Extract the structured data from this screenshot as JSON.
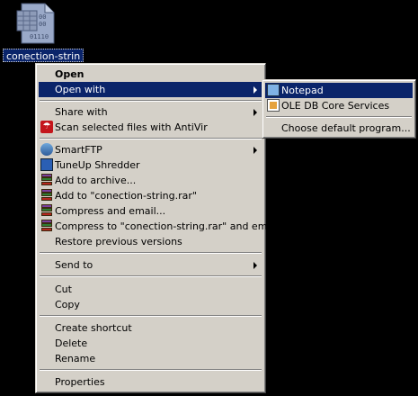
{
  "desktop": {
    "file_label": "conection-strin",
    "file_icon": "text-file-icon",
    "file_icon_text": "10\n01\n1110"
  },
  "context_menu": {
    "open": "Open",
    "open_with": "Open with",
    "share_with": "Share with",
    "scan_antivir": "Scan selected files with AntiVir",
    "smartftp": "SmartFTP",
    "tuneup_shredder": "TuneUp Shredder",
    "add_archive": "Add to archive...",
    "add_rar": "Add to \"conection-string.rar\"",
    "compress_email": "Compress and email...",
    "compress_rar_email": "Compress to \"conection-string.rar\" and email",
    "restore_versions": "Restore previous versions",
    "send_to": "Send to",
    "cut": "Cut",
    "copy": "Copy",
    "create_shortcut": "Create shortcut",
    "delete": "Delete",
    "rename": "Rename",
    "properties": "Properties"
  },
  "submenu": {
    "notepad": "Notepad",
    "oledb": "OLE DB Core Services",
    "choose_default": "Choose default program..."
  },
  "colors": {
    "menu_bg": "#d4d0c8",
    "highlight": "#0a246a",
    "desktop": "#000000"
  }
}
